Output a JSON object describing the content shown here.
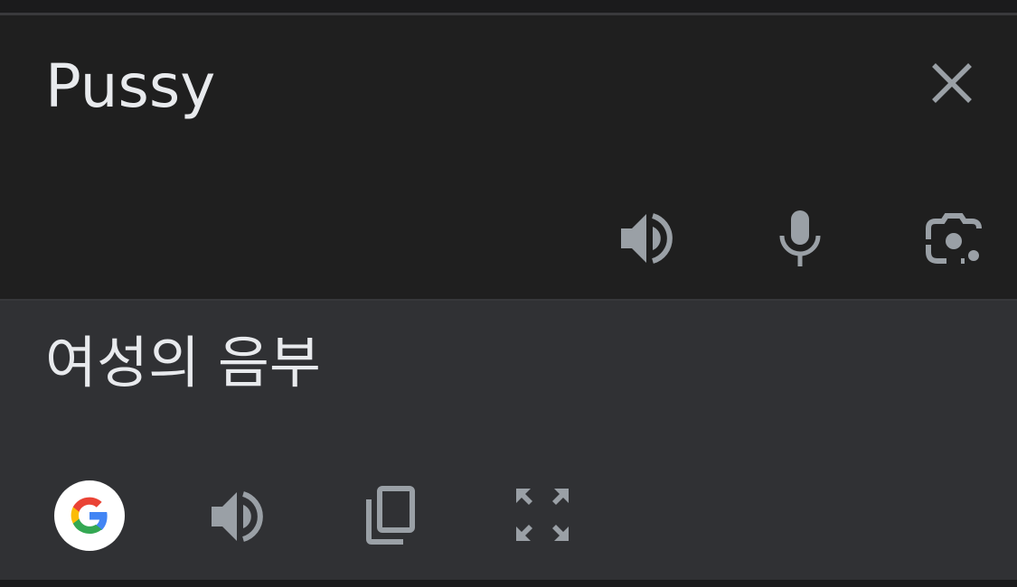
{
  "source": {
    "text": "Pussy",
    "actions": {
      "close_icon": "close-icon",
      "speak_icon": "speaker-icon",
      "mic_icon": "microphone-icon",
      "camera_icon": "camera-lens-icon"
    }
  },
  "translation": {
    "text": "여성의 음부",
    "actions": {
      "google_icon": "google-g-icon",
      "speak_icon": "speaker-icon",
      "copy_icon": "copy-icon",
      "expand_icon": "fullscreen-icon"
    }
  },
  "colors": {
    "source_bg": "#1f1f1f",
    "target_bg": "#303134",
    "text": "#e8eaed",
    "icon": "#9aa0a6",
    "google_blue": "#4285F4",
    "google_red": "#EA4335",
    "google_yellow": "#FBBC05",
    "google_green": "#34A853"
  }
}
